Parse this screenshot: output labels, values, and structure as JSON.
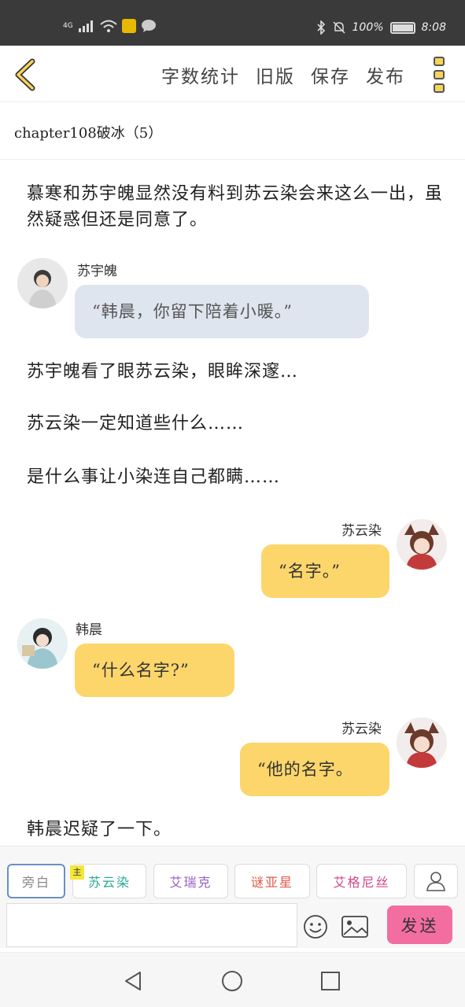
{
  "status_bar": {
    "network": "4G",
    "battery": "100%",
    "time": "8:08",
    "battery_level": 1.0
  },
  "toolbar": {
    "actions": [
      "字数统计",
      "旧版",
      "保存",
      "发布"
    ],
    "icons": {
      "back": "chevron-left-icon",
      "more": "more-dots-icon"
    }
  },
  "chapter": {
    "title": "chapter108破冰（5）"
  },
  "content": {
    "para1": "慕寒和苏宇魄显然没有料到苏云染会来这么一出，虽然疑惑但还是同意了。",
    "msg1": {
      "speaker": "苏宇魄",
      "text": "“韩晨，你留下陪着小暖。”"
    },
    "para2": "苏宇魄看了眼苏云染，眼眸深邃…",
    "para3": "苏云染一定知道些什么……",
    "para4": "是什么事让小染连自己都瞒……",
    "msg2": {
      "speaker": "苏云染",
      "text": "“名字。”"
    },
    "msg3": {
      "speaker": "韩晨",
      "text": "“什么名字?”"
    },
    "msg4": {
      "speaker": "苏云染",
      "text": "“他的名字。"
    },
    "para5": "韩晨迟疑了一下。"
  },
  "roles": {
    "narration": "旁白",
    "protagonist_tag": "主",
    "characters": [
      {
        "name": "苏云染",
        "color": "#2aa89a"
      },
      {
        "name": "艾瑞克",
        "color": "#9a5fc4"
      },
      {
        "name": "谜亚星",
        "color": "#e05a4a"
      },
      {
        "name": "艾格尼丝",
        "color": "#d0488c"
      }
    ]
  },
  "composer": {
    "send_label": "发送",
    "input_value": ""
  },
  "colors": {
    "bubble_gray": "#dfe5ee",
    "bubble_yellow": "#fcd66b",
    "send": "#f36ea0",
    "accent_yellow": "#f6d35a"
  }
}
